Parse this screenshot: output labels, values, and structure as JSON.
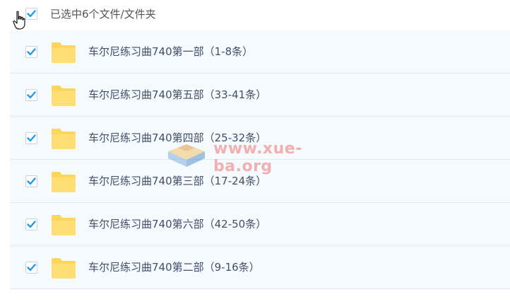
{
  "header": {
    "selected_label": "已选中6个文件/文件夹",
    "select_all_checked": true
  },
  "colors": {
    "accent": "#1e9bf0",
    "row_bg": "#f5faff",
    "row_border": "#dfe9f3",
    "folder": "#ffd659",
    "text": "#424e67"
  },
  "items": [
    {
      "name": "车尔尼练习曲740第一部（1-8条）",
      "type": "folder",
      "checked": true,
      "icon": "folder-icon"
    },
    {
      "name": "车尔尼练习曲740第五部（33-41条）",
      "type": "folder",
      "checked": true,
      "icon": "folder-icon"
    },
    {
      "name": "车尔尼练习曲740第四部（25-32条）",
      "type": "folder",
      "checked": true,
      "icon": "folder-icon"
    },
    {
      "name": "车尔尼练习曲740第三部（17-24条）",
      "type": "folder",
      "checked": true,
      "icon": "folder-icon"
    },
    {
      "name": "车尔尼练习曲740第六部（42-50条）",
      "type": "folder",
      "checked": true,
      "icon": "folder-icon"
    },
    {
      "name": "车尔尼练习曲740第二部（9-16条）",
      "type": "folder",
      "checked": true,
      "icon": "folder-icon"
    }
  ],
  "watermark": {
    "text": "www.xue-ba.org"
  }
}
